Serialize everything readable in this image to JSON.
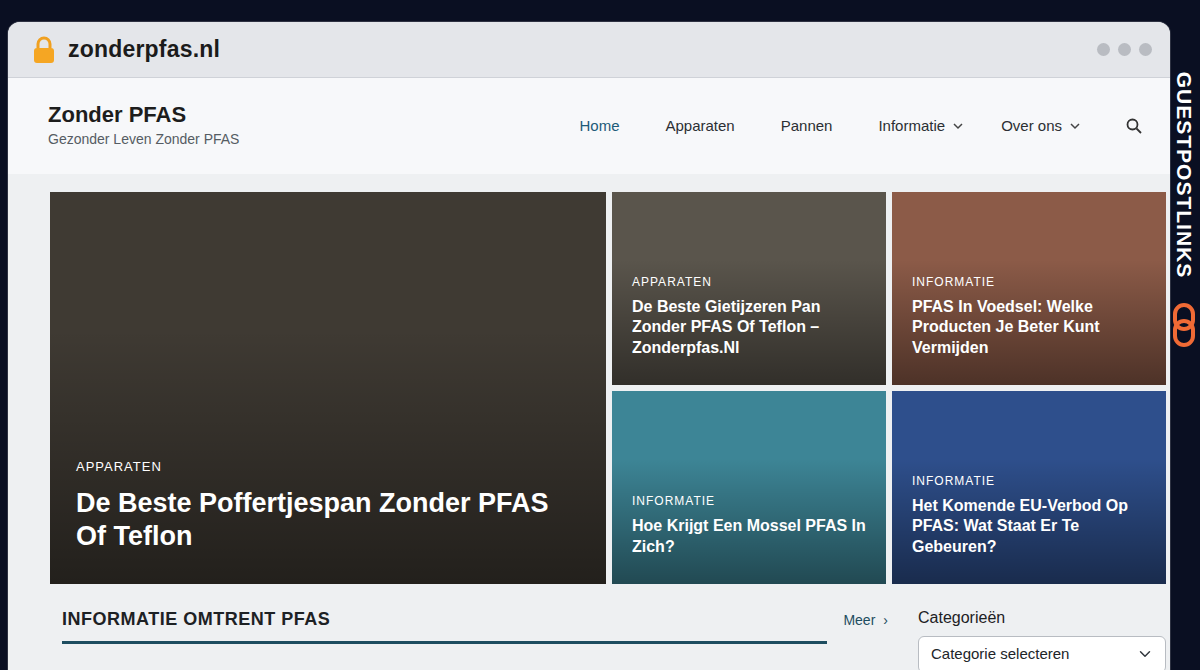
{
  "browser": {
    "url": "zonderpfas.nl",
    "secure": true
  },
  "watermark": "GUESTPOSTLINKS",
  "site": {
    "title": "Zonder PFAS",
    "tagline": "Gezonder Leven Zonder PFAS"
  },
  "nav": [
    {
      "label": "Home",
      "selected": true,
      "has_menu": false
    },
    {
      "label": "Apparaten",
      "selected": false,
      "has_menu": false
    },
    {
      "label": "Pannen",
      "selected": false,
      "has_menu": false
    },
    {
      "label": "Informatie",
      "selected": false,
      "has_menu": true
    },
    {
      "label": "Over ons",
      "selected": false,
      "has_menu": true
    }
  ],
  "featured": [
    {
      "category": "APPARATEN",
      "title": "De Beste Poffertjespan Zonder PFAS Of Teflon"
    },
    {
      "category": "APPARATEN",
      "title": "De Beste Gietijzeren Pan Zonder PFAS Of Teflon – Zonderpfas.Nl"
    },
    {
      "category": "INFORMATIE",
      "title": "PFAS In Voedsel: Welke Producten Je Beter Kunt Vermijden"
    },
    {
      "category": "INFORMATIE",
      "title": "Hoe Krijgt Een Mossel PFAS In Zich?"
    },
    {
      "category": "INFORMATIE",
      "title": "Het Komende EU-Verbod Op PFAS: Wat Staat Er Te Gebeuren?"
    }
  ],
  "section": {
    "title": "INFORMATIE OMTRENT PFAS",
    "more": "Meer",
    "more_icon": "›"
  },
  "sidebar": {
    "title": "Categorieën",
    "select": "Categorie selecteren"
  }
}
